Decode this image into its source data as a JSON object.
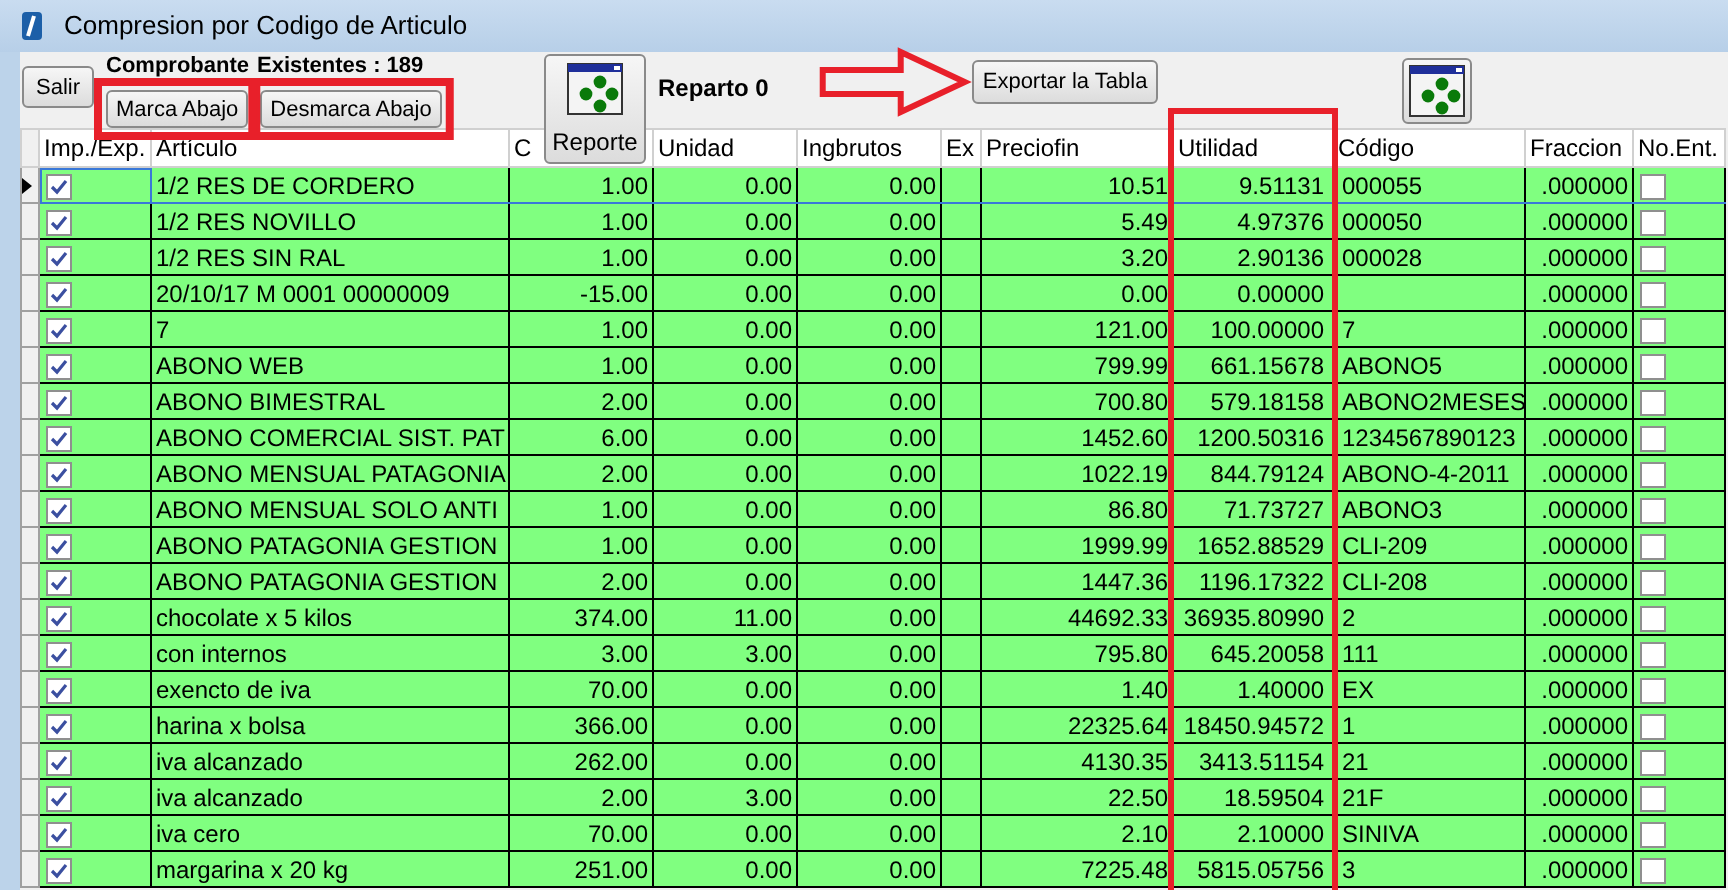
{
  "window": {
    "title": "Compresion por Codigo de Articulo"
  },
  "toolbar": {
    "comprobante_label": "Comprobante",
    "existentes_label": "Existentes : 189",
    "reparto_label": "Reparto 0",
    "buttons": [
      {
        "kind": "text",
        "label": "Salir"
      },
      {
        "kind": "text",
        "label": "Marca Abajo"
      },
      {
        "kind": "text",
        "label": "Desmarca Abajo"
      },
      {
        "kind": "icon_text",
        "label": "Reporte"
      },
      {
        "kind": "text",
        "label": "Exportar la Tabla"
      },
      {
        "kind": "icon"
      }
    ]
  },
  "annotations": [
    {
      "kind": "box"
    },
    {
      "kind": "box"
    },
    {
      "kind": "arrow"
    },
    {
      "kind": "box"
    }
  ],
  "table": {
    "columns": [
      "Imp./Exp.",
      "Artículo",
      "C",
      "Unidad",
      "Ingbrutos",
      "Ex",
      "Preciofin",
      "Utilidad",
      "Código",
      "Fraccion",
      "No.Ent."
    ],
    "rows": [
      {
        "current": true,
        "cells": [
          {
            "checked": true
          },
          "1/2 RES DE CORDERO",
          "1.00",
          "0.00",
          "0.00",
          "",
          "10.51",
          "9.51131",
          "000055",
          ".000000",
          {
            "checked": false
          }
        ]
      },
      {
        "current": false,
        "cells": [
          {
            "checked": true
          },
          "1/2 RES NOVILLO",
          "1.00",
          "0.00",
          "0.00",
          "",
          "5.49",
          "4.97376",
          "000050",
          ".000000",
          {
            "checked": false
          }
        ]
      },
      {
        "current": false,
        "cells": [
          {
            "checked": true
          },
          "1/2 RES SIN RAL",
          "1.00",
          "0.00",
          "0.00",
          "",
          "3.20",
          "2.90136",
          "000028",
          ".000000",
          {
            "checked": false
          }
        ]
      },
      {
        "current": false,
        "cells": [
          {
            "checked": true
          },
          "20/10/17 M 0001 00000009",
          "-15.00",
          "0.00",
          "0.00",
          "",
          "0.00",
          "0.00000",
          "",
          ".000000",
          {
            "checked": false
          }
        ]
      },
      {
        "current": false,
        "cells": [
          {
            "checked": true
          },
          "7",
          "1.00",
          "0.00",
          "0.00",
          "",
          "121.00",
          "100.00000",
          "7",
          ".000000",
          {
            "checked": false
          }
        ]
      },
      {
        "current": false,
        "cells": [
          {
            "checked": true
          },
          "ABONO  WEB",
          "1.00",
          "0.00",
          "0.00",
          "",
          "799.99",
          "661.15678",
          "ABONO5",
          ".000000",
          {
            "checked": false
          }
        ]
      },
      {
        "current": false,
        "cells": [
          {
            "checked": true
          },
          "ABONO BIMESTRAL",
          "2.00",
          "0.00",
          "0.00",
          "",
          "700.80",
          "579.18158",
          "ABONO2MESES",
          ".000000",
          {
            "checked": false
          }
        ]
      },
      {
        "current": false,
        "cells": [
          {
            "checked": true
          },
          "ABONO COMERCIAL SIST. PAT",
          "6.00",
          "0.00",
          "0.00",
          "",
          "1452.60",
          "1200.50316",
          "1234567890123",
          ".000000",
          {
            "checked": false
          }
        ]
      },
      {
        "current": false,
        "cells": [
          {
            "checked": true
          },
          "ABONO MENSUAL PATAGONIA",
          "2.00",
          "0.00",
          "0.00",
          "",
          "1022.19",
          "844.79124",
          "ABONO-4-2011",
          ".000000",
          {
            "checked": false
          }
        ]
      },
      {
        "current": false,
        "cells": [
          {
            "checked": true
          },
          "ABONO MENSUAL SOLO ANTI",
          "1.00",
          "0.00",
          "0.00",
          "",
          "86.80",
          "71.73727",
          "ABONO3",
          ".000000",
          {
            "checked": false
          }
        ]
      },
      {
        "current": false,
        "cells": [
          {
            "checked": true
          },
          "ABONO PATAGONIA GESTION",
          "1.00",
          "0.00",
          "0.00",
          "",
          "1999.99",
          "1652.88529",
          "CLI-209",
          ".000000",
          {
            "checked": false
          }
        ]
      },
      {
        "current": false,
        "cells": [
          {
            "checked": true
          },
          "ABONO PATAGONIA GESTION",
          "2.00",
          "0.00",
          "0.00",
          "",
          "1447.36",
          "1196.17322",
          "CLI-208",
          ".000000",
          {
            "checked": false
          }
        ]
      },
      {
        "current": false,
        "cells": [
          {
            "checked": true
          },
          "chocolate x 5 kilos",
          "374.00",
          "11.00",
          "0.00",
          "",
          "44692.33",
          "36935.80990",
          "2",
          ".000000",
          {
            "checked": false
          }
        ]
      },
      {
        "current": false,
        "cells": [
          {
            "checked": true
          },
          "con internos",
          "3.00",
          "3.00",
          "0.00",
          "",
          "795.80",
          "645.20058",
          "111",
          ".000000",
          {
            "checked": false
          }
        ]
      },
      {
        "current": false,
        "cells": [
          {
            "checked": true
          },
          "exencto de iva",
          "70.00",
          "0.00",
          "0.00",
          "",
          "1.40",
          "1.40000",
          "EX",
          ".000000",
          {
            "checked": false
          }
        ]
      },
      {
        "current": false,
        "cells": [
          {
            "checked": true
          },
          "harina x bolsa",
          "366.00",
          "0.00",
          "0.00",
          "",
          "22325.64",
          "18450.94572",
          "1",
          ".000000",
          {
            "checked": false
          }
        ]
      },
      {
        "current": false,
        "cells": [
          {
            "checked": true
          },
          "iva alcanzado",
          "262.00",
          "0.00",
          "0.00",
          "",
          "4130.35",
          "3413.51154",
          "21",
          ".000000",
          {
            "checked": false
          }
        ]
      },
      {
        "current": false,
        "cells": [
          {
            "checked": true
          },
          "iva alcanzado",
          "2.00",
          "3.00",
          "0.00",
          "",
          "22.50",
          "18.59504",
          "21F",
          ".000000",
          {
            "checked": false
          }
        ]
      },
      {
        "current": false,
        "cells": [
          {
            "checked": true
          },
          "iva cero",
          "70.00",
          "0.00",
          "0.00",
          "",
          "2.10",
          "2.10000",
          "SINIVA",
          ".000000",
          {
            "checked": false
          }
        ]
      },
      {
        "current": false,
        "cells": [
          {
            "checked": true
          },
          "margarina x 20 kg",
          "251.00",
          "0.00",
          "0.00",
          "",
          "7225.48",
          "5815.05756",
          "3",
          ".000000",
          {
            "checked": false
          }
        ]
      }
    ]
  }
}
